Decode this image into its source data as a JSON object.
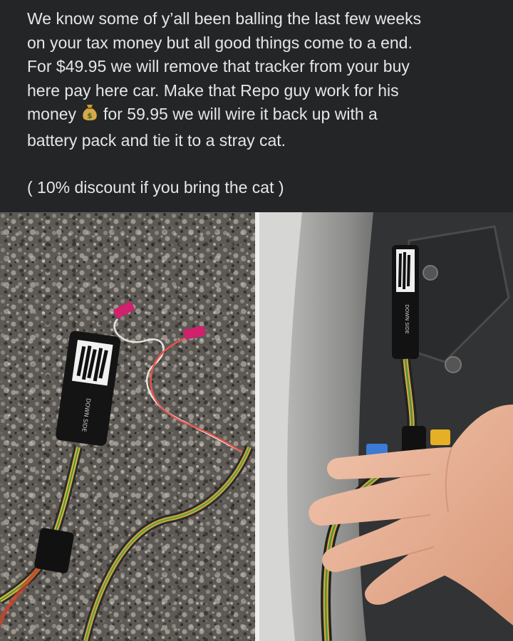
{
  "post": {
    "line1": "We know some of y’all been balling the last few weeks",
    "line2": "on your tax money but all good things come to a end.",
    "line3": "For $49.95 we will remove that tracker from your buy",
    "line4": "here pay here car. Make that Repo guy work for his",
    "line5a": "money",
    "line5b": "for 59.95 we will wire it back up with a",
    "line6": "battery pack and tie it to a stray cat.",
    "line7": "( 10% discount if you bring the cat )",
    "emoji_icon": "money-bag-icon"
  },
  "photos": {
    "left": {
      "subject": "gps-tracker-on-asphalt",
      "device_label": "DOWN SIDE"
    },
    "right": {
      "subject": "gps-tracker-in-car-door-held-by-hand",
      "device_label": "DOWN SIDE"
    }
  },
  "colors": {
    "background": "#242526",
    "text": "#e4e6eb"
  }
}
